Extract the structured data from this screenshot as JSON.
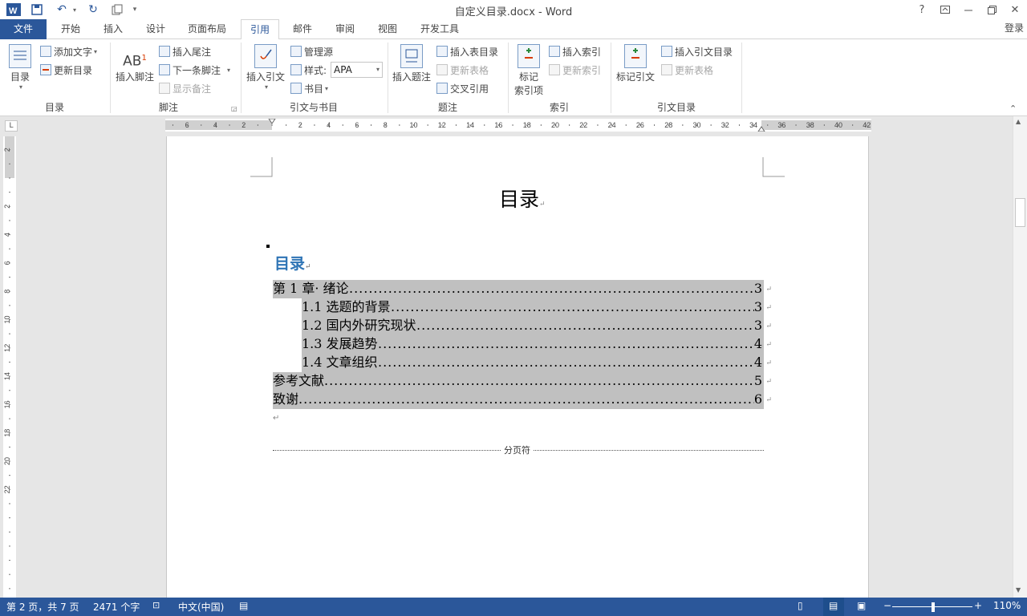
{
  "window": {
    "title": "自定义目录.docx - Word"
  },
  "quick_access": {
    "undo_icon": "undo-icon",
    "redo_icon": "redo-icon"
  },
  "window_controls": {
    "help": "?"
  },
  "tabs": [
    {
      "label": "文件"
    },
    {
      "label": "开始"
    },
    {
      "label": "插入"
    },
    {
      "label": "设计"
    },
    {
      "label": "页面布局"
    },
    {
      "label": "引用"
    },
    {
      "label": "邮件"
    },
    {
      "label": "审阅"
    },
    {
      "label": "视图"
    },
    {
      "label": "开发工具"
    }
  ],
  "login": "登录",
  "ribbon": {
    "toc": {
      "big": "目录",
      "add_text": "添加文字",
      "update": "更新目录",
      "group": "目录"
    },
    "footnote": {
      "big": "插入脚注",
      "insert_endnote": "插入尾注",
      "next_footnote": "下一条脚注",
      "show_notes": "显示备注",
      "group": "脚注"
    },
    "citation": {
      "big": "插入引文",
      "manage": "管理源",
      "style_label": "样式:",
      "style_value": "APA",
      "bibliography": "书目",
      "group": "引文与书目"
    },
    "caption": {
      "big": "插入题注",
      "insert_table_of_figures": "插入表目录",
      "update_table": "更新表格",
      "cross_ref": "交叉引用",
      "group": "题注"
    },
    "index": {
      "big_line1": "标记",
      "big_line2": "索引项",
      "insert_index": "插入索引",
      "update_index": "更新索引",
      "group": "索引"
    },
    "toa": {
      "big": "标记引文",
      "insert_toa": "插入引文目录",
      "update_table": "更新表格",
      "group": "引文目录"
    }
  },
  "ruler": {
    "h_ticks": [
      "6",
      "4",
      "2",
      "2",
      "4",
      "6",
      "8",
      "10",
      "12",
      "14",
      "16",
      "18",
      "20",
      "22",
      "24",
      "26",
      "28",
      "30",
      "32",
      "34",
      "36",
      "38",
      "40",
      "42"
    ],
    "v_ticks": [
      "2",
      "2",
      "4",
      "6",
      "8",
      "10",
      "12",
      "14",
      "16",
      "18",
      "20",
      "22"
    ]
  },
  "document": {
    "page_title": "目录",
    "toc_heading": "目录",
    "toc": [
      {
        "text": "第 1 章· 绪论",
        "page": "3",
        "level": 1
      },
      {
        "text": "1.1 选题的背景",
        "page": "3",
        "level": 2
      },
      {
        "text": "1.2 国内外研究现状",
        "page": "3",
        "level": 2
      },
      {
        "text": "1.3 发展趋势",
        "page": "4",
        "level": 2
      },
      {
        "text": "1.4 文章组织",
        "page": "4",
        "level": 2
      },
      {
        "text": "参考文献",
        "page": "5",
        "level": 1
      },
      {
        "text": "致谢",
        "page": "6",
        "level": 1
      }
    ],
    "page_break": "分页符",
    "para_mark": "↵"
  },
  "status": {
    "page": "第 2 页，共 7 页",
    "words": "2471 个字",
    "language": "中文(中国)",
    "zoom": "110%"
  },
  "colors": {
    "accent": "#2b579a",
    "toc_shade": "#c0c0c0",
    "heading_blue": "#2e74b5"
  }
}
